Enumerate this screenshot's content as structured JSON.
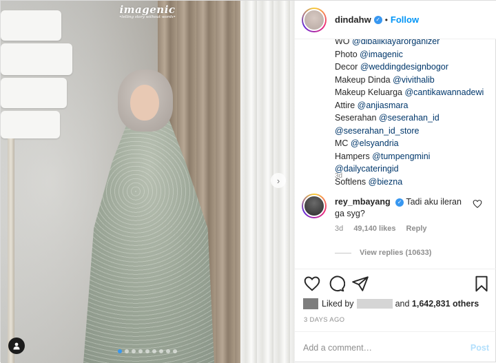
{
  "photo": {
    "watermark_title": "imagenic",
    "watermark_tagline": "•telling story without words•",
    "carousel_dots": 9,
    "carousel_active": 0
  },
  "header": {
    "username": "dindahw",
    "separator": "•",
    "follow_label": "Follow"
  },
  "caption": {
    "lines": [
      [
        {
          "t": "WO "
        },
        {
          "m": "@dibaliklayarorganizer"
        }
      ],
      [
        {
          "t": "Photo "
        },
        {
          "m": "@imagenic"
        }
      ],
      [
        {
          "t": "Decor "
        },
        {
          "m": "@weddingdesignbogor"
        }
      ],
      [
        {
          "t": "Makeup Dinda "
        },
        {
          "m": "@vivithalib"
        }
      ],
      [
        {
          "t": "Makeup Keluarga "
        },
        {
          "m": "@cantikawannadewi"
        }
      ],
      [
        {
          "t": "Attire "
        },
        {
          "m": "@anjiasmara"
        }
      ],
      [
        {
          "t": "Seserahan "
        },
        {
          "m": "@seserahan_id"
        }
      ],
      [
        {
          "m": "@seserahan_id_store"
        }
      ],
      [
        {
          "t": "MC "
        },
        {
          "m": "@elsyandria"
        }
      ],
      [
        {
          "t": "Hampers "
        },
        {
          "m": "@tumpengmini"
        }
      ],
      [
        {
          "m": "@dailycateringid"
        }
      ],
      [
        {
          "t": "Softlens "
        },
        {
          "m": "@biezna"
        }
      ]
    ],
    "time": "3d"
  },
  "comment": {
    "username": "rey_mbayang",
    "text": "Tadi aku ileran ga syg?",
    "time": "3d",
    "likes": "49,140 likes",
    "reply_label": "Reply",
    "view_replies": "View replies (10633)"
  },
  "likes": {
    "prefix": "Liked by",
    "and": "and",
    "count": "1,642,831 others"
  },
  "date": "3 DAYS AGO",
  "add_comment": {
    "placeholder": "Add a comment…",
    "post_label": "Post"
  },
  "colors": {
    "accent": "#0095f6",
    "verified": "#3897f0",
    "mention": "#00376b",
    "muted": "#8e8e8e"
  }
}
